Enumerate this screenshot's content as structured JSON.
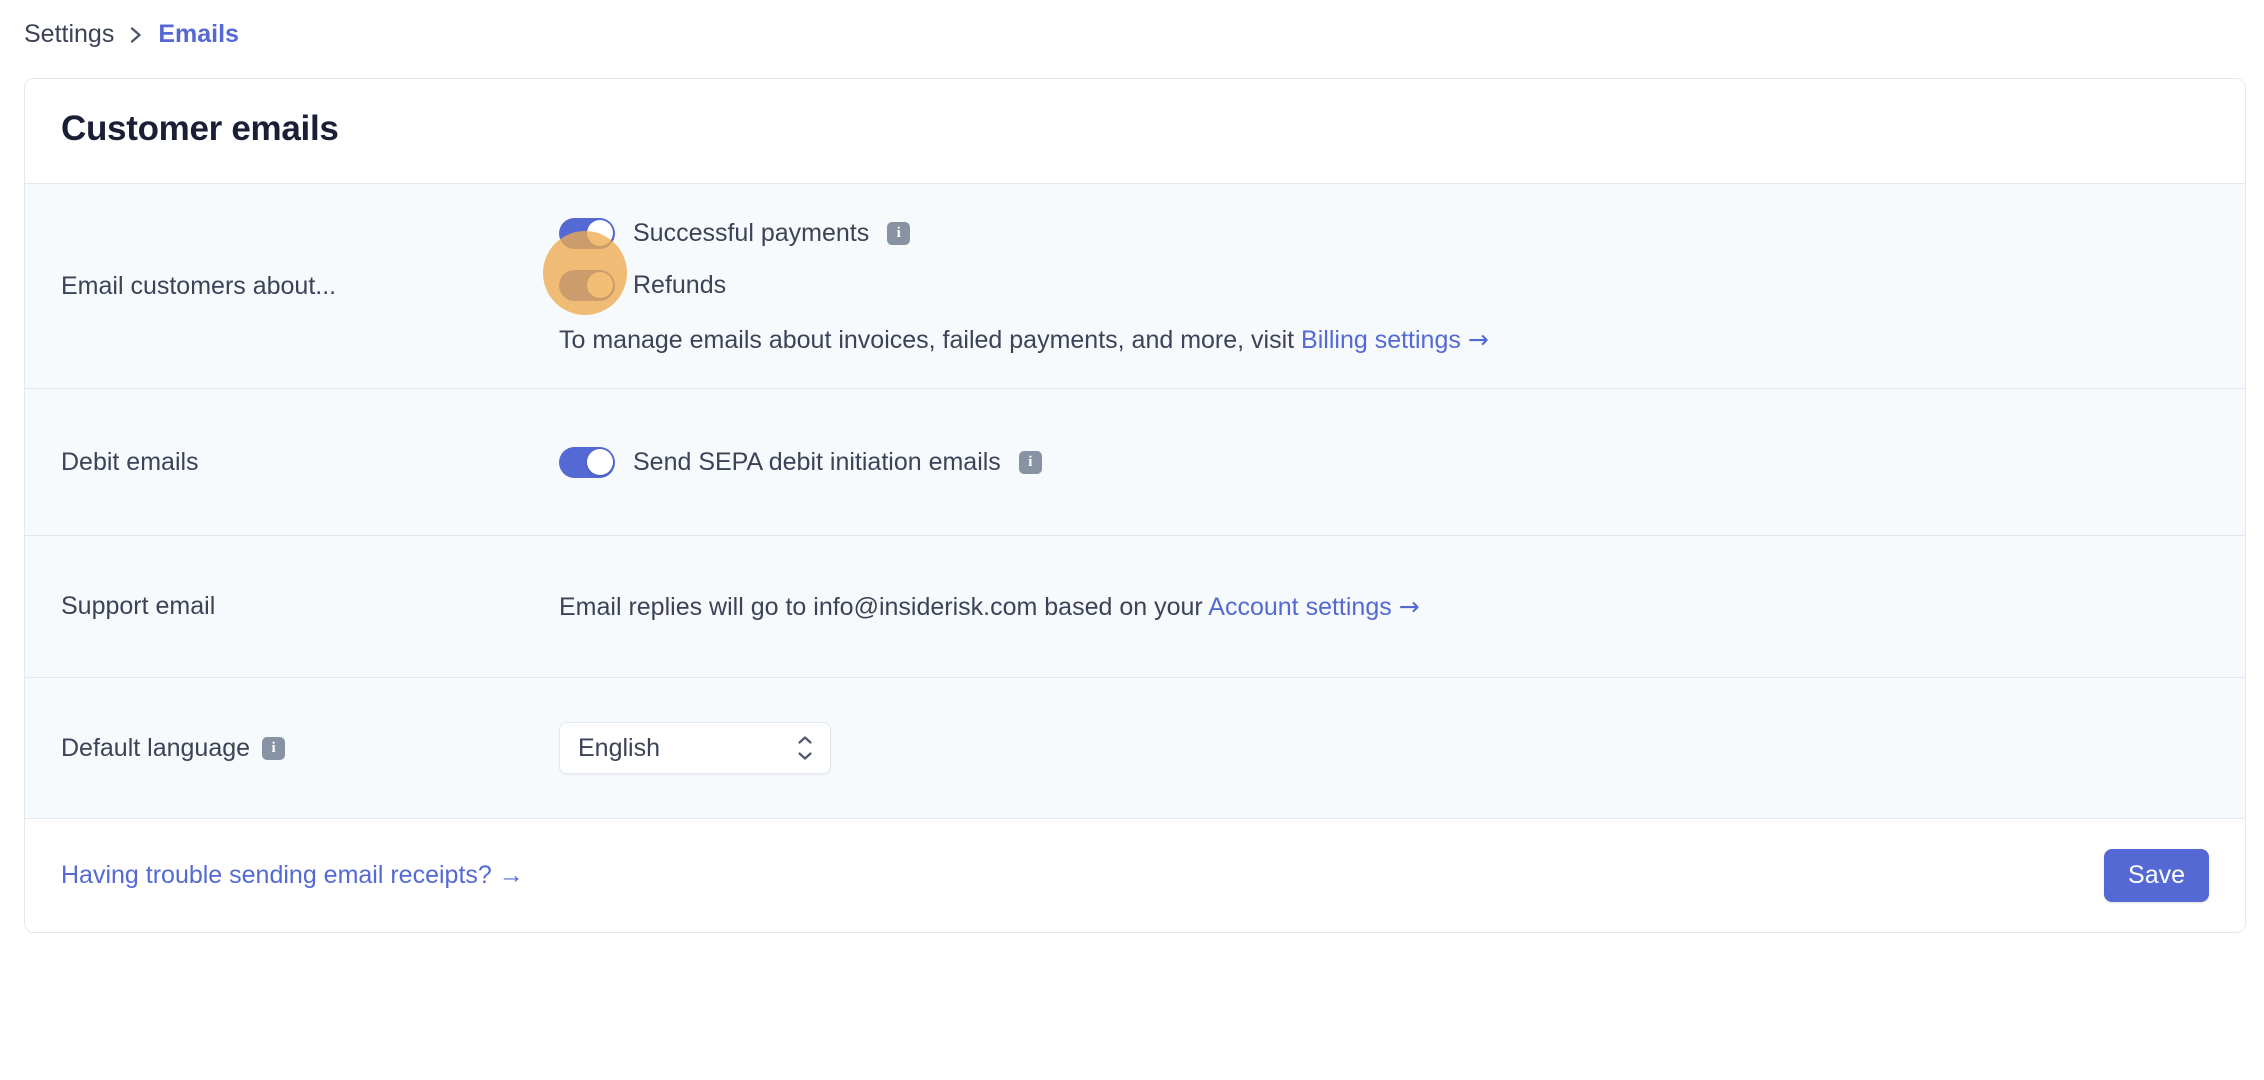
{
  "breadcrumb": {
    "root": "Settings",
    "separator_icon": "chevron-right-icon",
    "current": "Emails"
  },
  "card": {
    "title": "Customer emails",
    "rows": {
      "email_customers": {
        "label": "Email customers about...",
        "toggles": [
          {
            "label": "Successful payments",
            "state": "on",
            "has_info": true
          },
          {
            "label": "Refunds",
            "state": "on",
            "has_info": false
          }
        ],
        "helper_prefix": "To manage emails about invoices, failed payments, and more, visit ",
        "helper_link": "Billing settings",
        "helper_arrow": "→"
      },
      "debit_emails": {
        "label": "Debit emails",
        "toggle": {
          "label": "Send SEPA debit initiation emails",
          "state": "on",
          "has_info": true
        }
      },
      "support_email": {
        "label": "Support email",
        "text_prefix": "Email replies will go to ",
        "address": "info@insiderisk.com",
        "text_middle": " based on your ",
        "link": "Account settings",
        "arrow": "→"
      },
      "default_language": {
        "label": "Default language",
        "has_info": true,
        "select_value": "English",
        "select_icon": "chevron-up-down-icon"
      }
    },
    "footer": {
      "link": "Having trouble sending email receipts?",
      "link_arrow": "→",
      "save_label": "Save"
    }
  },
  "colors": {
    "accent": "#5469d4",
    "toggle_on": "#5469d4",
    "info_badge": "#8792a2",
    "row_background": "#f7fafc",
    "border": "#e3e8ee",
    "text": "#3c4257",
    "heading": "#1a1f36",
    "cursor_highlight": "#eeab4e"
  }
}
